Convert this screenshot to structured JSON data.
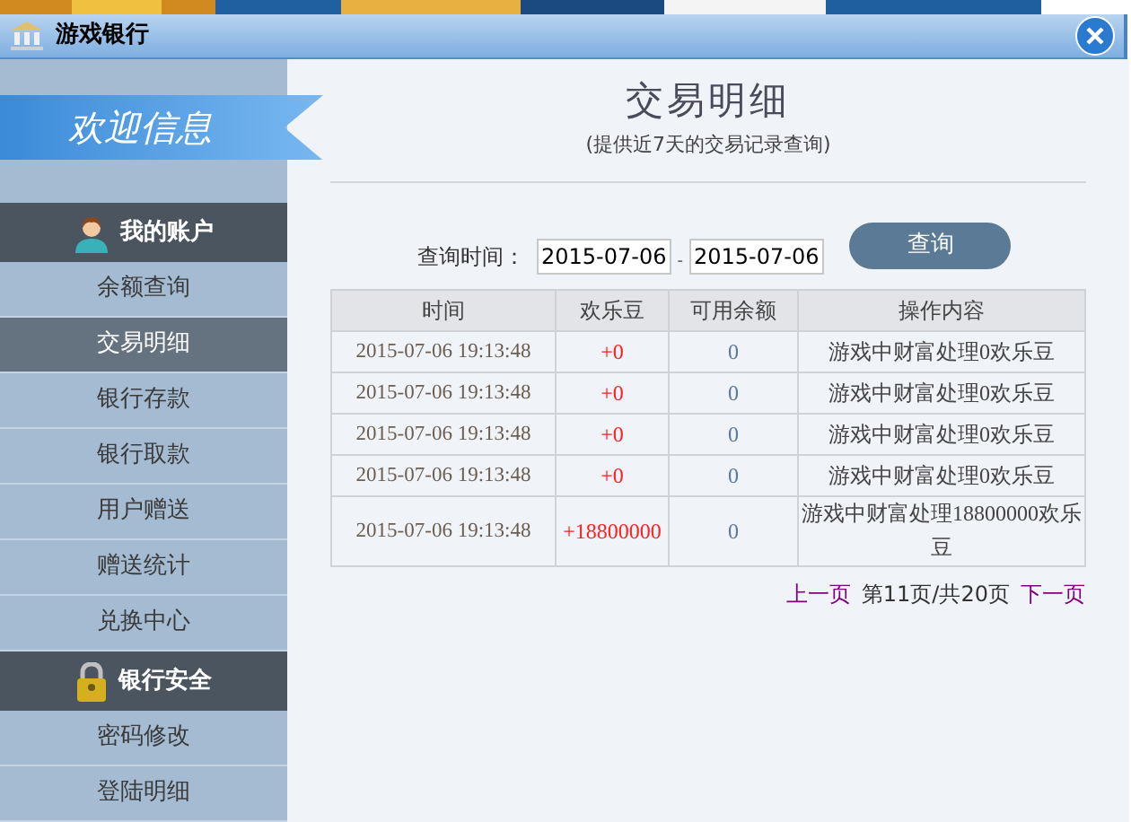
{
  "window": {
    "title": "游戏银行"
  },
  "banner": {
    "text": "欢迎信息"
  },
  "sidebar": {
    "sections": [
      {
        "title": "我的账户",
        "kind": "user",
        "items": [
          {
            "label": "余额查询",
            "selected": false
          },
          {
            "label": "交易明细",
            "selected": true
          },
          {
            "label": "银行存款",
            "selected": false
          },
          {
            "label": "银行取款",
            "selected": false
          },
          {
            "label": "用户赠送",
            "selected": false
          },
          {
            "label": "赠送统计",
            "selected": false
          },
          {
            "label": "兑换中心",
            "selected": false
          }
        ]
      },
      {
        "title": "银行安全",
        "kind": "lock",
        "items": [
          {
            "label": "密码修改",
            "selected": false
          },
          {
            "label": "登陆明细",
            "selected": false
          }
        ]
      }
    ]
  },
  "page": {
    "title": "交易明细",
    "subtitle": "(提供近7天的交易记录查询)"
  },
  "query": {
    "label": "查询时间：",
    "start": "2015-07-06",
    "separator": "-",
    "end": "2015-07-06",
    "button": "查询"
  },
  "table": {
    "columns": [
      "时间",
      "欢乐豆",
      "可用余额",
      "操作内容"
    ],
    "rows": [
      [
        "2015-07-06 19:13:48",
        "+0",
        "0",
        "游戏中财富处理0欢乐豆"
      ],
      [
        "2015-07-06 19:13:48",
        "+0",
        "0",
        "游戏中财富处理0欢乐豆"
      ],
      [
        "2015-07-06 19:13:48",
        "+0",
        "0",
        "游戏中财富处理0欢乐豆"
      ],
      [
        "2015-07-06 19:13:48",
        "+0",
        "0",
        "游戏中财富处理0欢乐豆"
      ],
      [
        "2015-07-06 19:13:48",
        "+18800000",
        "0",
        "游戏中财富处理18800000欢乐豆"
      ]
    ]
  },
  "pagination": {
    "previous": "上一页",
    "status": "第11页/共20页",
    "next": "下一页"
  }
}
